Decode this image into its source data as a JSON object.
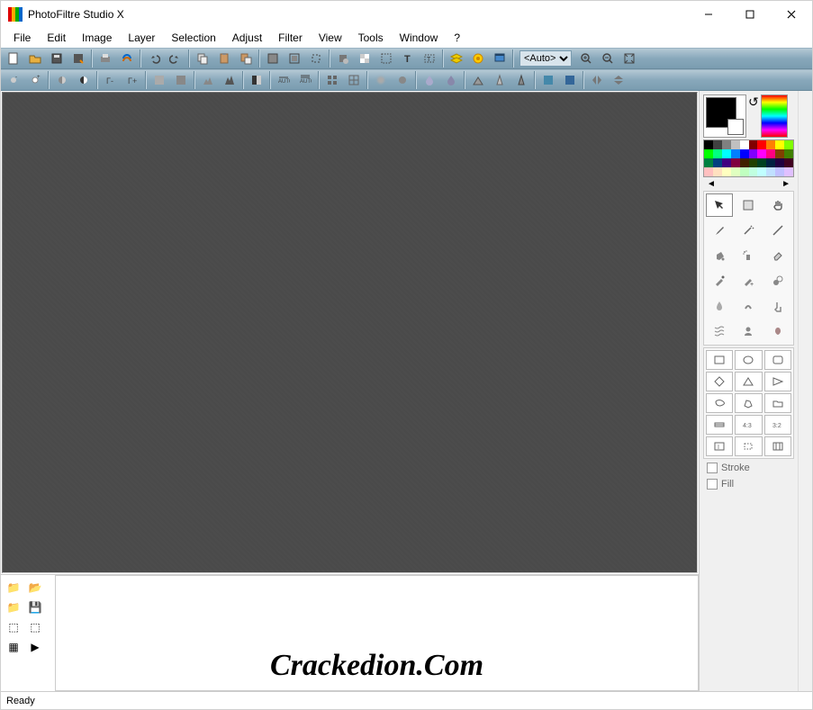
{
  "window": {
    "title": "PhotoFiltre Studio X"
  },
  "menubar": {
    "items": [
      "File",
      "Edit",
      "Image",
      "Layer",
      "Selection",
      "Adjust",
      "Filter",
      "View",
      "Tools",
      "Window",
      "?"
    ]
  },
  "toolbar1": {
    "zoom_select": "<Auto>",
    "buttons": [
      "new",
      "open",
      "save",
      "save-as",
      "print",
      "scan",
      "undo",
      "redo",
      "copy",
      "paste",
      "paste-special",
      "image-size",
      "canvas-size",
      "crop",
      "auto-levels",
      "transparency",
      "selection",
      "text",
      "stamp",
      "layers",
      "plugins",
      "preferences",
      "help"
    ]
  },
  "toolbar2": {
    "buttons": [
      "brightness-minus",
      "brightness-plus",
      "contrast-minus",
      "contrast-plus",
      "gamma-minus",
      "gamma-plus",
      "saturation-minus",
      "saturation-plus",
      "histogram-minus",
      "histogram-plus",
      "grayscale",
      "auto-contrast",
      "auto-levels-2",
      "tile-1",
      "tile-2",
      "blur",
      "blur-more",
      "drop",
      "drop-2",
      "relief",
      "sharpen",
      "sharpen-more",
      "colorize",
      "flip-h",
      "flip-v"
    ]
  },
  "right_panel": {
    "stroke_label": "Stroke",
    "fill_label": "Fill",
    "nav_left": "◄",
    "nav_right": "►"
  },
  "palette_colors": [
    "#000000",
    "#404040",
    "#808080",
    "#c0c0c0",
    "#ffffff",
    "#800000",
    "#ff0000",
    "#ff8000",
    "#ffff00",
    "#80ff00",
    "#00ff00",
    "#00ff80",
    "#00ffff",
    "#0080ff",
    "#0000ff",
    "#8000ff",
    "#ff00ff",
    "#ff0080",
    "#804000",
    "#408000",
    "#008040",
    "#004080",
    "#400080",
    "#800040",
    "#402000",
    "#204000",
    "#004020",
    "#002040",
    "#200040",
    "#400020",
    "#ffc0c0",
    "#ffe0c0",
    "#ffffc0",
    "#e0ffc0",
    "#c0ffc0",
    "#c0ffe0",
    "#c0ffff",
    "#c0e0ff",
    "#c0c0ff",
    "#e0c0ff"
  ],
  "tools": {
    "items": [
      "pointer",
      "selection-tool",
      "hand",
      "eyedropper",
      "wand",
      "line",
      "bucket",
      "spray",
      "eraser",
      "brush",
      "advanced-brush",
      "clone",
      "drop-tool",
      "smudge",
      "finger",
      "distort",
      "portrait",
      "art"
    ]
  },
  "shapes": {
    "items": [
      "rect",
      "ellipse",
      "rounded",
      "diamond",
      "triangle",
      "right-triangle",
      "lasso",
      "polygon",
      "folder",
      "ratio-free",
      "ratio-43",
      "ratio-32",
      "text-bound",
      "crop-bound",
      "grid-bound"
    ]
  },
  "watermark": "Crackedion.Com",
  "statusbar": {
    "text": "Ready"
  }
}
